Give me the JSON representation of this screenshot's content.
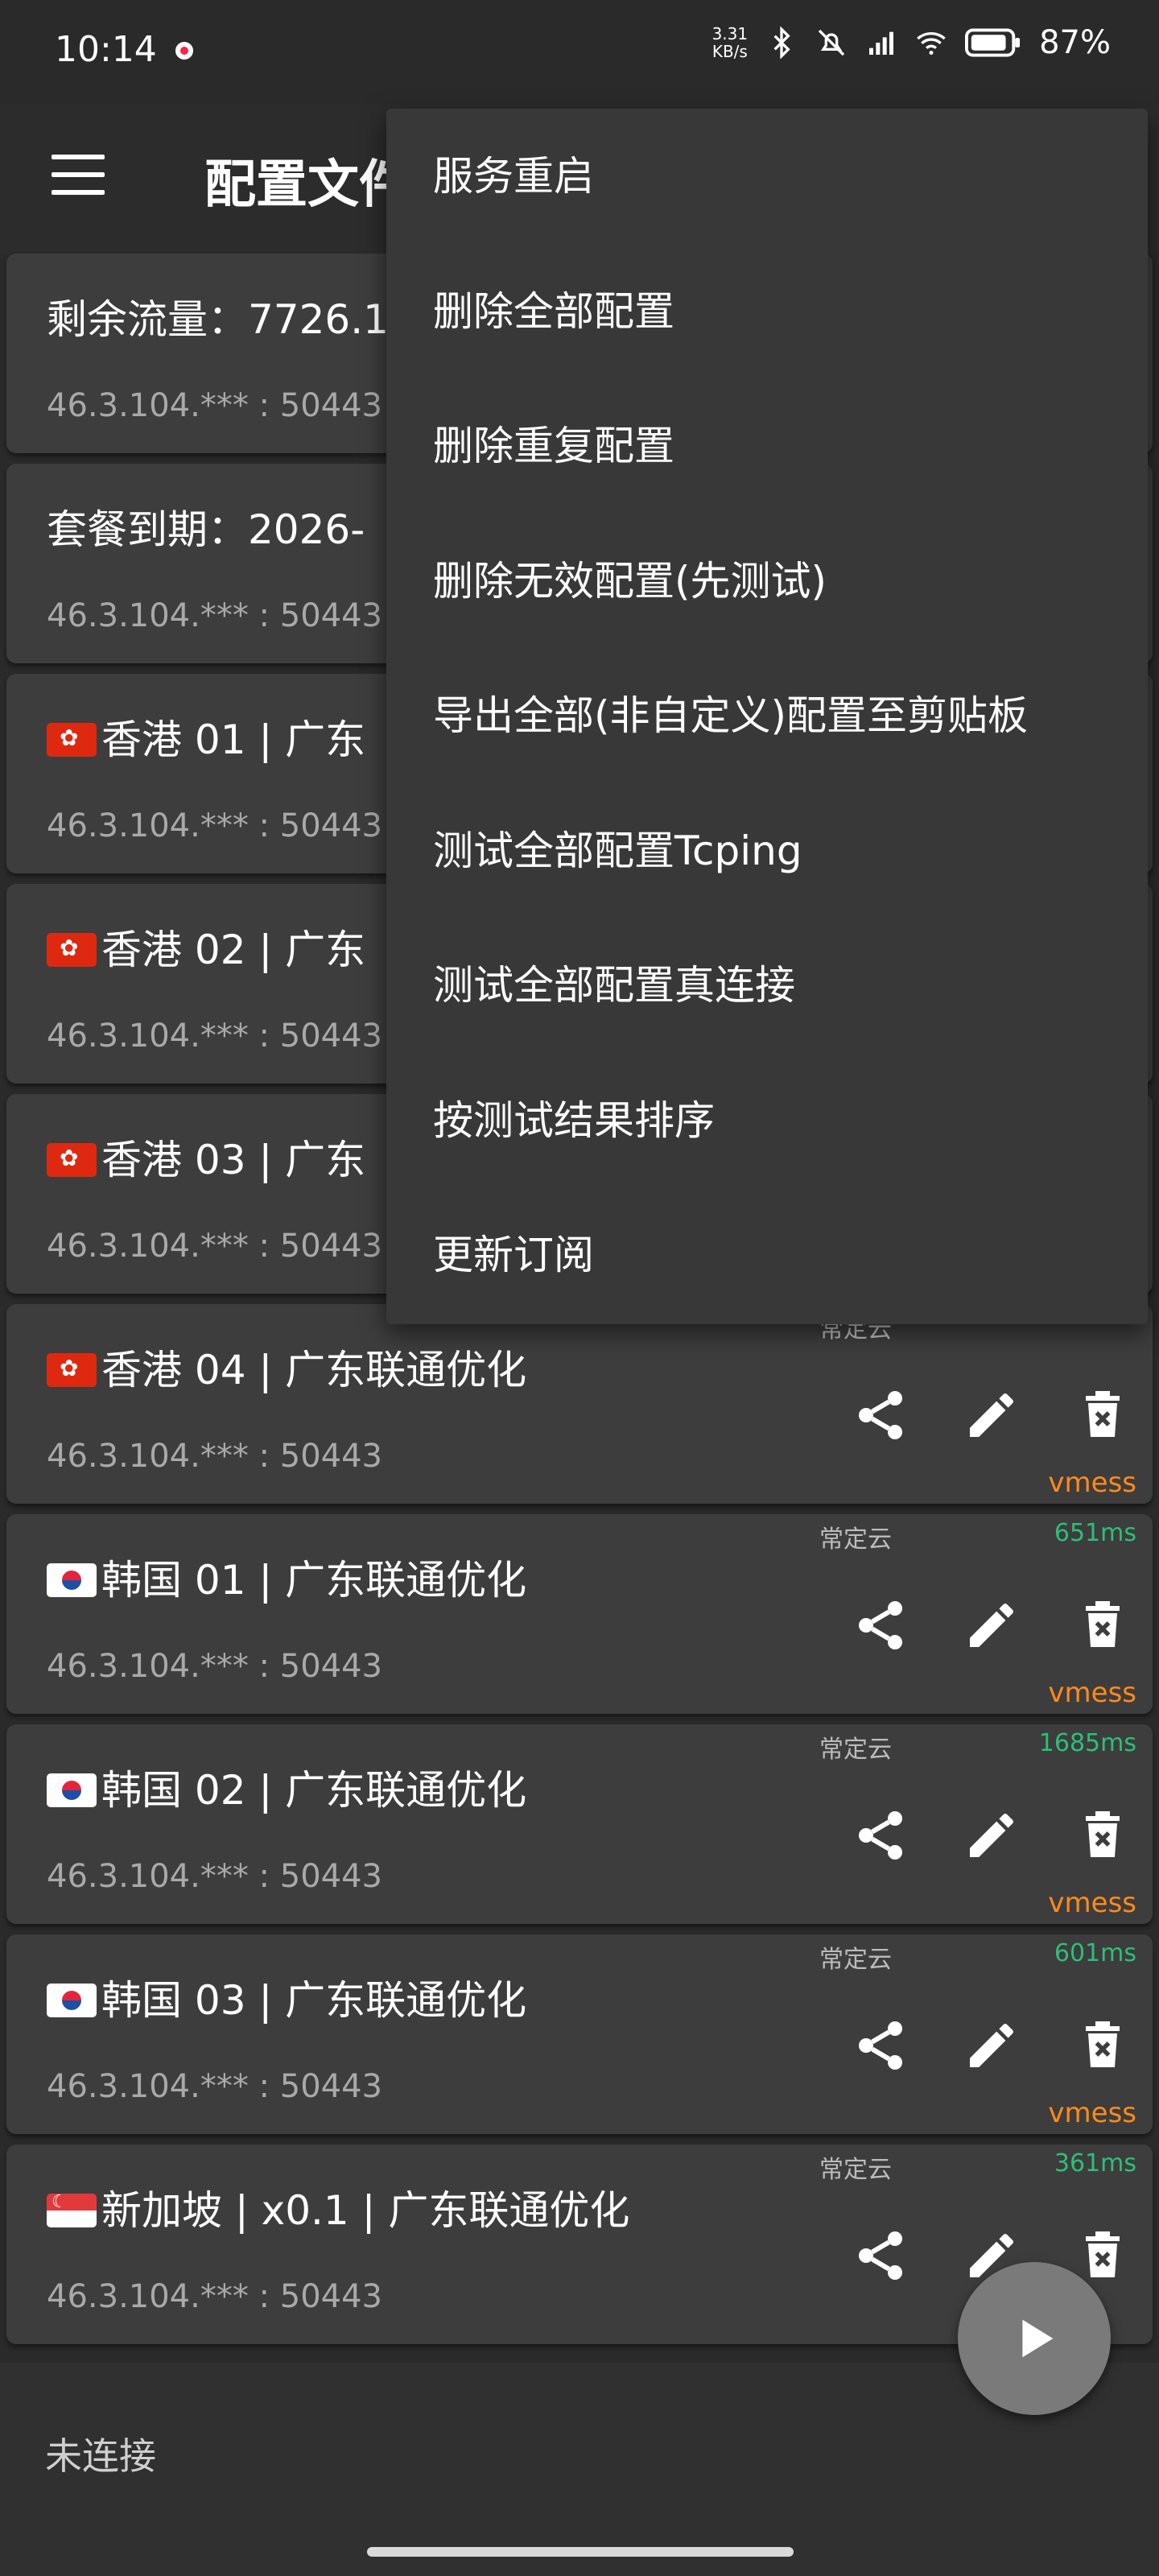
{
  "status_bar": {
    "time": "10:14",
    "net_speed_value": "3.31",
    "net_speed_unit": "KB/s",
    "battery": "87%"
  },
  "toolbar": {
    "title": "配置文件"
  },
  "profiles": [
    {
      "flag": "",
      "name": "剩余流量：7726.1",
      "address": "46.3.104.*** : 50443",
      "group": "",
      "latency": "",
      "protocol": ""
    },
    {
      "flag": "",
      "name": "套餐到期：2026-",
      "address": "46.3.104.*** : 50443",
      "group": "",
      "latency": "",
      "protocol": ""
    },
    {
      "flag": "hk",
      "name": "香港 01 | 广东",
      "address": "46.3.104.*** : 50443",
      "group": "",
      "latency": "",
      "protocol": ""
    },
    {
      "flag": "hk",
      "name": "香港 02 | 广东",
      "address": "46.3.104.*** : 50443",
      "group": "",
      "latency": "",
      "protocol": ""
    },
    {
      "flag": "hk",
      "name": "香港 03 | 广东",
      "address": "46.3.104.*** : 50443",
      "group": "",
      "latency": "",
      "protocol": ""
    },
    {
      "flag": "hk",
      "name": "香港 04 | 广东联通优化",
      "address": "46.3.104.*** : 50443",
      "group": "常定云",
      "latency": "",
      "protocol": "vmess"
    },
    {
      "flag": "kr",
      "name": "韩国 01 | 广东联通优化",
      "address": "46.3.104.*** : 50443",
      "group": "常定云",
      "latency": "651ms",
      "protocol": "vmess"
    },
    {
      "flag": "kr",
      "name": "韩国 02 | 广东联通优化",
      "address": "46.3.104.*** : 50443",
      "group": "常定云",
      "latency": "1685ms",
      "protocol": "vmess"
    },
    {
      "flag": "kr",
      "name": "韩国 03 | 广东联通优化",
      "address": "46.3.104.*** : 50443",
      "group": "常定云",
      "latency": "601ms",
      "protocol": "vmess"
    },
    {
      "flag": "sg",
      "name": "新加坡 | x0.1 | 广东联通优化",
      "address": "46.3.104.*** : 50443",
      "group": "常定云",
      "latency": "361ms",
      "protocol": ""
    }
  ],
  "menu": {
    "items": [
      "服务重启",
      "删除全部配置",
      "删除重复配置",
      "删除无效配置(先测试)",
      "导出全部(非自定义)配置至剪贴板",
      "测试全部配置Tcping",
      "测试全部配置真连接",
      "按测试结果排序",
      "更新订阅"
    ]
  },
  "bottom": {
    "connection_status": "未连接"
  },
  "icons": {
    "menu": "hamburger-icon",
    "share": "share-icon",
    "edit": "edit-icon",
    "delete": "delete-icon",
    "fab": "play-icon"
  },
  "colors": {
    "latency": "#2dbf78",
    "protocol": "#ff8a1c",
    "card_bg": "#3d3d3d",
    "menu_bg": "#383838"
  }
}
